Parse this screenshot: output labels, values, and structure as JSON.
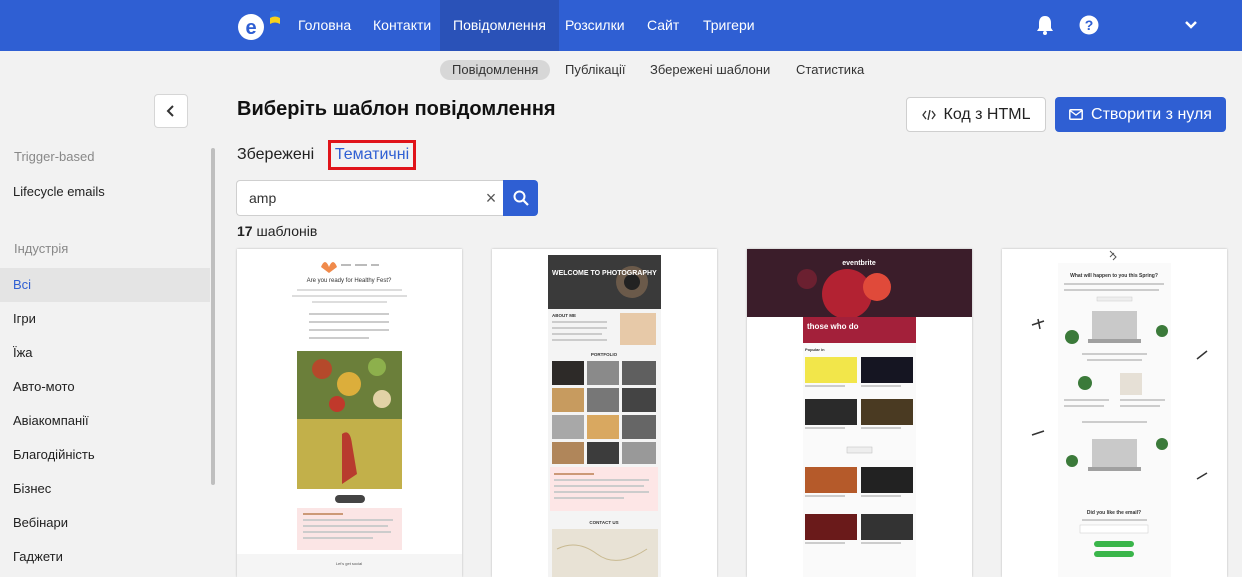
{
  "nav": {
    "items": [
      "Головна",
      "Контакти",
      "Повідомлення",
      "Розсилки",
      "Сайт",
      "Тригери"
    ],
    "active": "Повідомлення"
  },
  "subnav": {
    "items": [
      "Повідомлення",
      "Публікації",
      "Збережені шаблони",
      "Статистика"
    ],
    "active": "Повідомлення"
  },
  "sidebar": {
    "section1_label": "Trigger-based",
    "section1_items": [
      "Lifecycle emails"
    ],
    "section2_label": "Індустрія",
    "section2_items": [
      "Всі",
      "Ігри",
      "Їжа",
      "Авто-мото",
      "Авіакомпанії",
      "Благодійність",
      "Бізнес",
      "Вебінари",
      "Гаджети"
    ],
    "active": "Всі"
  },
  "page": {
    "title": "Виберіть шаблон повідомлення",
    "html_button": "Код з HTML",
    "create_button": "Створити з нуля",
    "tab_saved": "Збережені",
    "tab_thematic": "Тематичні",
    "search_value": "amp",
    "count_number": "17",
    "count_label": "шаблонів"
  },
  "templates": [
    {
      "heading": "Are you ready for Healthy Fest?",
      "footer": "Let's get social"
    },
    {
      "heading": "WELCOME TO PHOTOGRAPHY",
      "section1": "ABOUT ME",
      "section2": "PORTFOLIO",
      "section3": "CONTACT US"
    },
    {
      "brand": "eventbrite",
      "hero": "those who do",
      "section": "Popular in"
    },
    {
      "heading": "What will happen to you this Spring?",
      "question": "Did you like the email?"
    }
  ],
  "colors": {
    "primary": "#2f5fd3",
    "highlight_border": "#e0141a",
    "active_nav_bg": "#2a52b8"
  },
  "icons": [
    "logo-e-icon",
    "bell-icon",
    "help-icon",
    "chevron-down-icon",
    "chevron-left-icon",
    "code-icon",
    "mail-icon",
    "close-icon",
    "search-icon"
  ]
}
